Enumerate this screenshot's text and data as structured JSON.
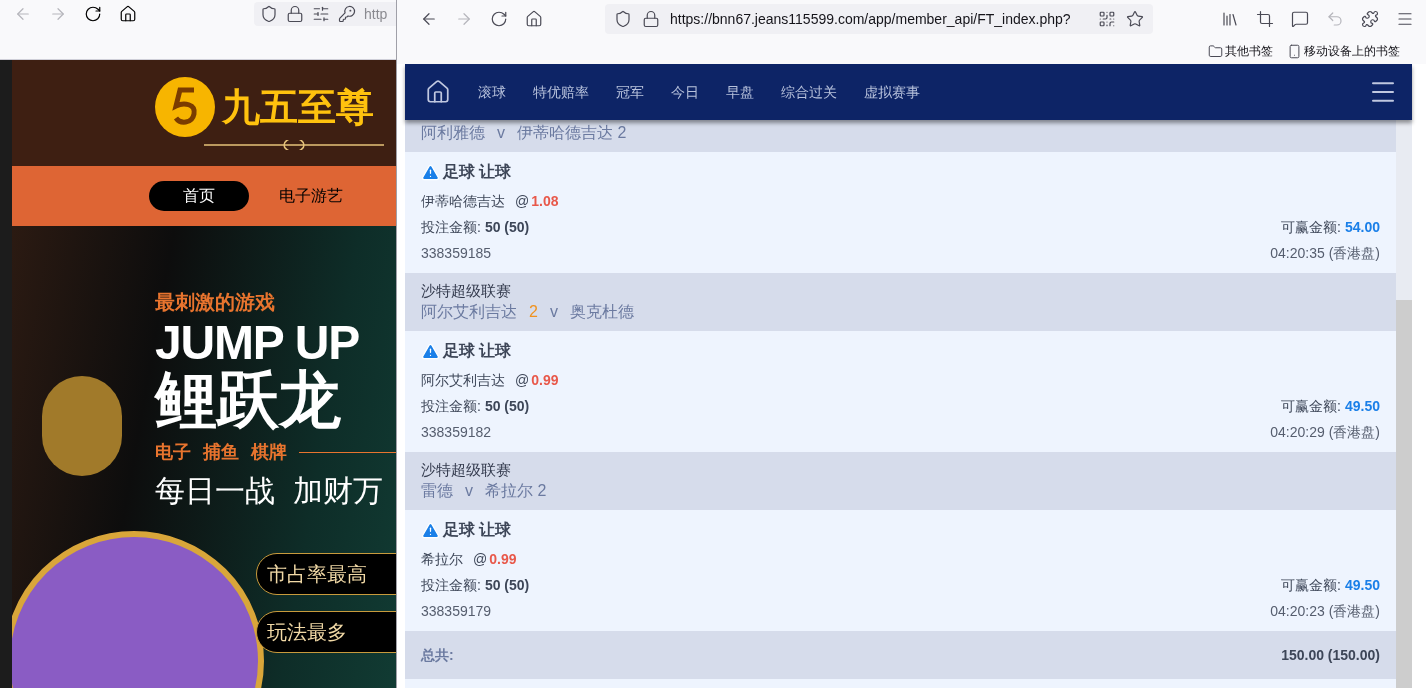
{
  "left_window": {
    "toolbar": {
      "address": "http"
    },
    "site": {
      "logo_text": "九五至尊",
      "nav": [
        {
          "label": "首页",
          "selected": true
        },
        {
          "label": "电子游艺",
          "selected": false
        }
      ],
      "banner": {
        "tagline": "最刺激的游戏",
        "headline": "JUMP UP",
        "title": "鲤跃龙",
        "categories": [
          "电子",
          "捕鱼",
          "棋牌"
        ],
        "slogan": [
          "每日一战",
          "加财万"
        ],
        "badges": [
          "市占率最高",
          "玩法最多"
        ]
      }
    }
  },
  "right_window": {
    "toolbar": {
      "address": "https://bnn67.jeans115599.com/app/member_api/FT_index.php?"
    },
    "bookmarks": [
      "其他书签",
      "移动设备上的书签"
    ],
    "nav": [
      "滚球",
      "特优赔率",
      "冠军",
      "今日",
      "早盘",
      "综合过关",
      "虚拟赛事"
    ],
    "bets": [
      {
        "home": "阿利雅德",
        "versus": "v",
        "away": "伊蒂哈德吉达 2",
        "bet_type": "足球 让球",
        "selection": "伊蒂哈德吉达",
        "odds_prefix": "@",
        "odds": "1.08",
        "stake_label": "投注金额:",
        "stake": "50 (50)",
        "win_label": "可赢金额:",
        "win": "54.00",
        "ticket": "338359185",
        "time": "04:20:35 (香港盘)"
      },
      {
        "league": "沙特超级联赛",
        "home": "阿尔艾利吉达",
        "score": "2",
        "versus": "v",
        "away": "奥克杜德",
        "bet_type": "足球 让球",
        "selection": "阿尔艾利吉达",
        "odds_prefix": "@",
        "odds": "0.99",
        "stake_label": "投注金额:",
        "stake": "50 (50)",
        "win_label": "可赢金额:",
        "win": "49.50",
        "ticket": "338359182",
        "time": "04:20:29 (香港盘)"
      },
      {
        "league": "沙特超级联赛",
        "home": "雷德",
        "versus": "v",
        "away": "希拉尔 2",
        "bet_type": "足球 让球",
        "selection": "希拉尔",
        "odds_prefix": "@",
        "odds": "0.99",
        "stake_label": "投注金额:",
        "stake": "50 (50)",
        "win_label": "可赢金额:",
        "win": "49.50",
        "ticket": "338359179",
        "time": "04:20:23 (香港盘)"
      }
    ],
    "total": {
      "label": "总共:",
      "value": "150.00 (150.00)"
    }
  }
}
